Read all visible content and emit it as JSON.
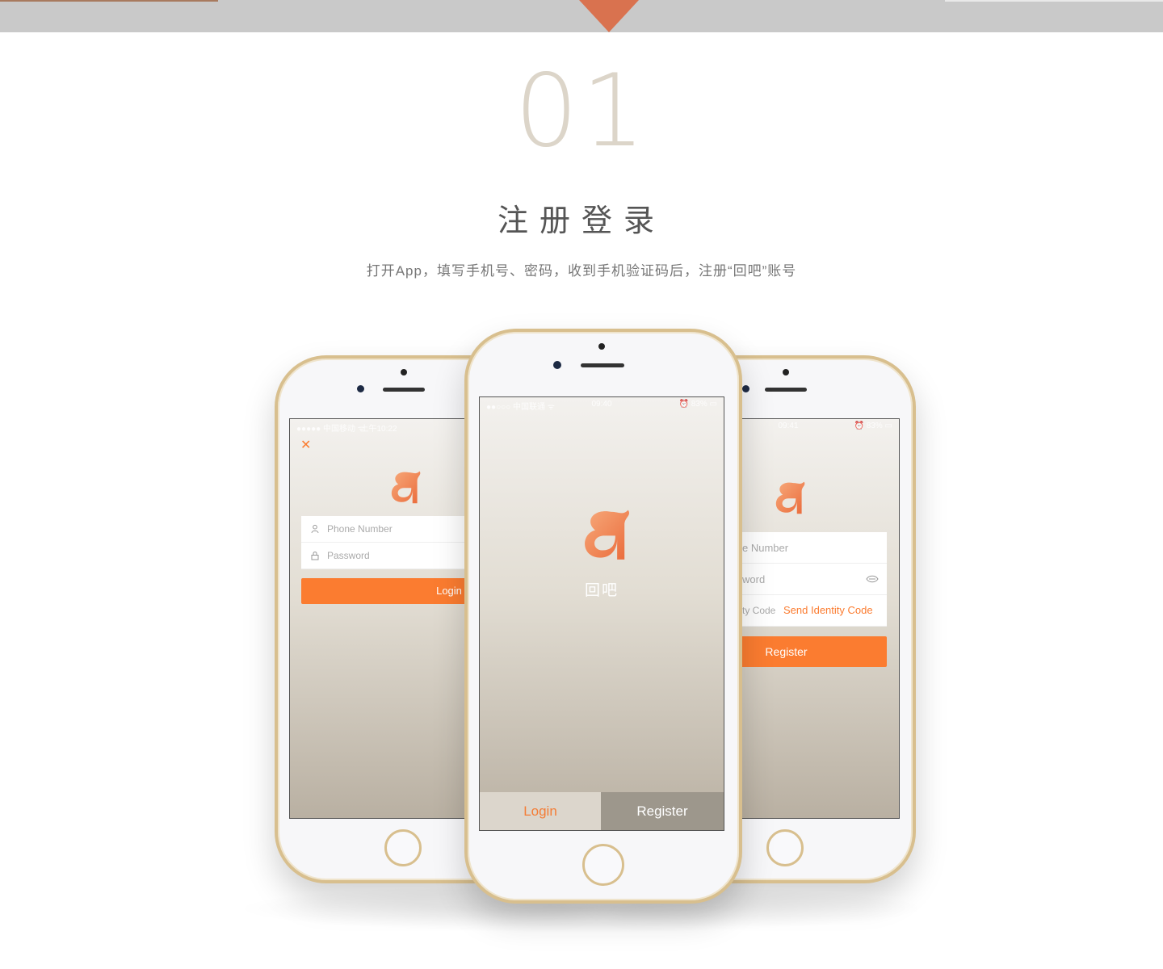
{
  "header": {
    "step_number": "01",
    "title": "注册登录",
    "description": "打开App，填写手机号、密码，收到手机验证码后，注册“回吧”账号"
  },
  "colors": {
    "accent": "#fb7c30",
    "marker": "#d9724f",
    "phone_frame": "#d8bf8e"
  },
  "phones": {
    "left": {
      "status_carrier": "●●●●● 中国移动 ᯤ",
      "status_time": "上午10:22",
      "close_icon": "close-icon",
      "phone_placeholder": "Phone Number",
      "password_placeholder": "Password",
      "login_label": "Login"
    },
    "center": {
      "status_carrier": "●●○○○ 中国联通 ᯤ",
      "status_time": "09:40",
      "status_battery": "⏰ 83% ▭",
      "app_name": "回吧",
      "tab_login": "Login",
      "tab_register": "Register"
    },
    "right": {
      "status_time": "09:41",
      "status_battery": "⏰ 83% ▭",
      "phone_placeholder": "e Number",
      "password_placeholder": "word",
      "code_placeholder": "ty Code",
      "send_code_label": "Send Identity Code",
      "register_label": "Register"
    }
  }
}
